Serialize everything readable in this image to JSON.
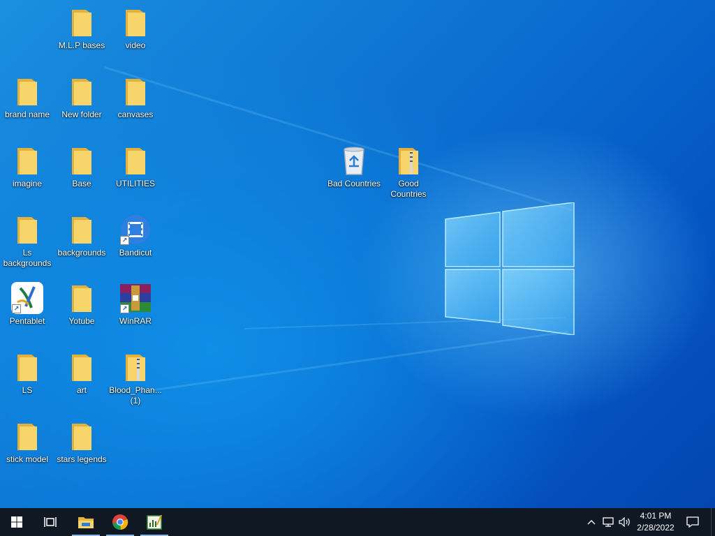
{
  "desktop": {
    "icons": [
      {
        "label": "M.L.P bases",
        "type": "folder"
      },
      {
        "label": "video",
        "type": "folder"
      },
      {
        "label": "brand name",
        "type": "folder"
      },
      {
        "label": "New folder",
        "type": "folder"
      },
      {
        "label": "canvases",
        "type": "folder"
      },
      {
        "label": "imagine",
        "type": "folder"
      },
      {
        "label": "Base",
        "type": "folder"
      },
      {
        "label": "UTILITIES",
        "type": "folder"
      },
      {
        "label": "Ls backgrounds",
        "type": "folder"
      },
      {
        "label": "backgrounds",
        "type": "folder"
      },
      {
        "label": "Bandicut",
        "type": "bandicut-shortcut"
      },
      {
        "label": "Pentablet",
        "type": "pentablet-shortcut"
      },
      {
        "label": "Yotube",
        "type": "folder"
      },
      {
        "label": "WinRAR",
        "type": "winrar-shortcut"
      },
      {
        "label": "LS",
        "type": "folder"
      },
      {
        "label": "art",
        "type": "folder"
      },
      {
        "label": "Blood_Phan... (1)",
        "type": "zip-folder"
      },
      {
        "label": "stick model",
        "type": "folder"
      },
      {
        "label": "stars legends",
        "type": "folder"
      },
      {
        "label": "Bad Countries",
        "type": "recycle-bin"
      },
      {
        "label": "Good Countries",
        "type": "zip-folder"
      }
    ]
  },
  "taskbar": {
    "start_icon": "windows-logo",
    "task_view_icon": "task-view",
    "pinned": [
      {
        "name": "file-explorer-icon",
        "active": true
      },
      {
        "name": "chrome-icon",
        "active": true
      },
      {
        "name": "pentablet-app-icon",
        "active": true
      }
    ],
    "tray": {
      "chevron": "^",
      "network_icon": "network",
      "volume_icon": "volume"
    },
    "clock": {
      "time": "4:01 PM",
      "date": "2/28/2022"
    },
    "notification_icon": "action-center"
  },
  "colors": {
    "taskbar_bg": "#101824",
    "folder_yellow": "#f7cf5a",
    "wallpaper_blue": "#0b6fd0"
  }
}
